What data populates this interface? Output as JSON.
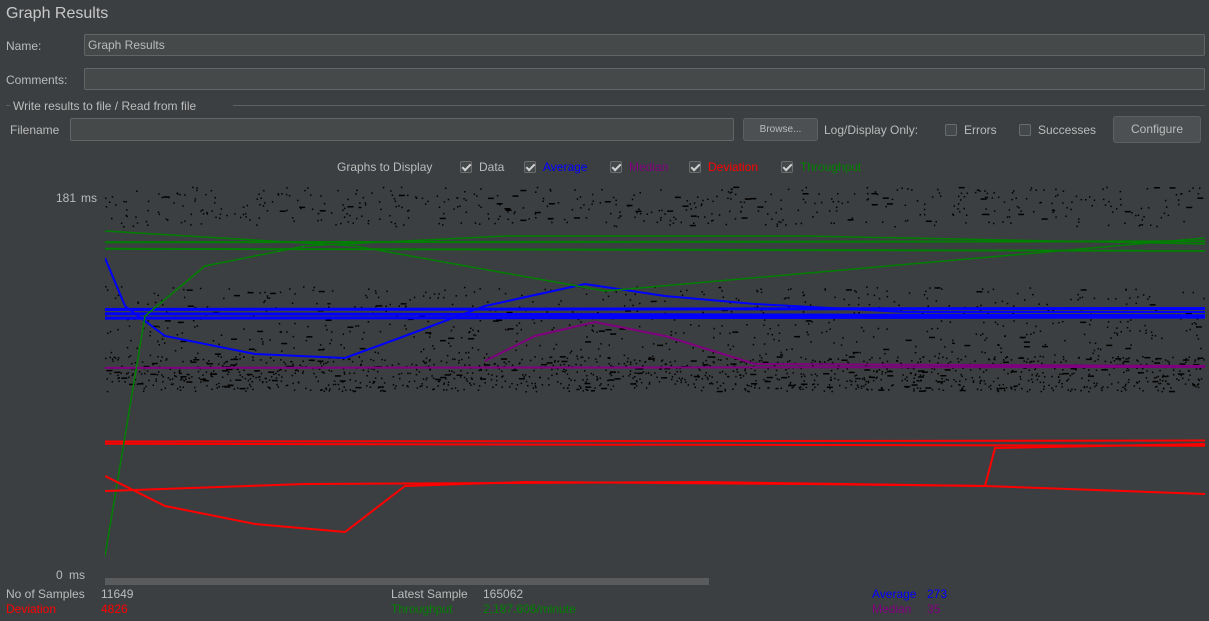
{
  "window": {
    "title": "Graph Results"
  },
  "form": {
    "name_label": "Name:",
    "name_value": "Graph Results",
    "comments_label": "Comments:",
    "comments_value": ""
  },
  "file_group": {
    "title": "Write results to file / Read from file",
    "filename_label": "Filename",
    "filename_value": "",
    "browse_label": "Browse...",
    "log_display_label": "Log/Display Only:",
    "errors_label": "Errors",
    "errors_checked": false,
    "successes_label": "Successes",
    "successes_checked": false,
    "configure_label": "Configure"
  },
  "graphs_to_display": {
    "label": "Graphs to Display",
    "options": [
      {
        "label": "Data",
        "checked": true,
        "color": "#bbbbbb"
      },
      {
        "label": "Average",
        "checked": true,
        "color": "#0000ff"
      },
      {
        "label": "Median",
        "checked": true,
        "color": "#800080"
      },
      {
        "label": "Deviation",
        "checked": true,
        "color": "#ff0000"
      },
      {
        "label": "Throughput",
        "checked": true,
        "color": "#008000"
      }
    ]
  },
  "chart_data": {
    "type": "line",
    "y_max_label": "181",
    "y_min_label": "0",
    "y_unit": "ms",
    "ylim": [
      0,
      181
    ],
    "series": [
      {
        "name": "Average",
        "color": "#0000ff",
        "levels": [
          124,
          122,
          120
        ]
      },
      {
        "name": "Median",
        "color": "#800080",
        "levels": [
          97
        ]
      },
      {
        "name": "Deviation",
        "color": "#ff0000",
        "levels": [
          63,
          62
        ]
      },
      {
        "name": "Throughput",
        "color": "#008000",
        "levels": [
          155,
          152
        ]
      }
    ]
  },
  "stats": {
    "samples_label": "No of Samples",
    "samples_value": "11649",
    "latest_label": "Latest Sample",
    "latest_value": "165062",
    "average_label": "Average",
    "average_value": "273",
    "deviation_label": "Deviation",
    "deviation_value": "4826",
    "throughput_label": "Throughput",
    "throughput_value": "2,187.606/minute",
    "median_label": "Median",
    "median_value": "35"
  },
  "colors": {
    "background": "#3c3f41",
    "plot_background": "#3c3f41",
    "data_points": "#000000",
    "average": "#0000ff",
    "median": "#800080",
    "deviation": "#ff0000",
    "throughput": "#008000"
  }
}
